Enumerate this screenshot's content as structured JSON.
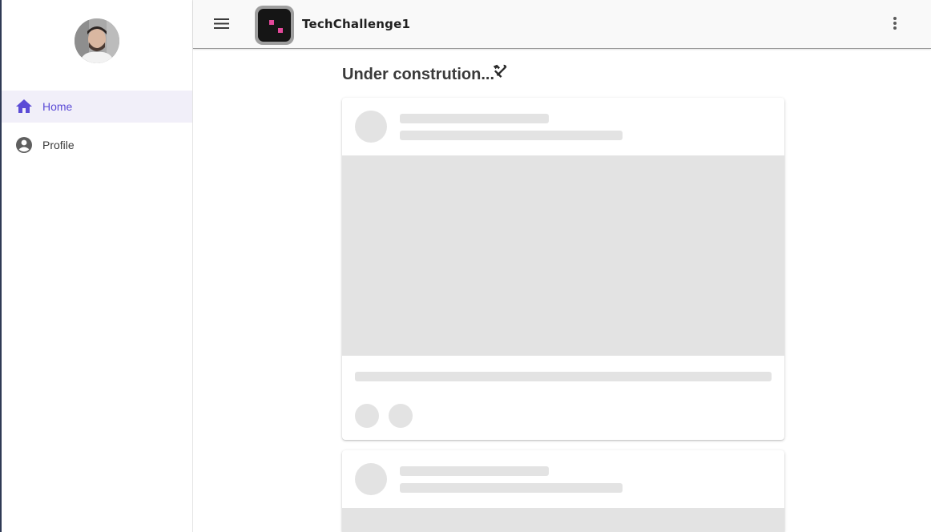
{
  "window": {
    "title": "TechChallenge1"
  },
  "sidebar": {
    "user_avatar_alt": "User avatar",
    "items": [
      {
        "label": "Home",
        "icon": "home-icon",
        "active": true
      },
      {
        "label": "Profile",
        "icon": "account-circle-icon",
        "active": false
      }
    ]
  },
  "header": {
    "app_title": "TechChallenge1",
    "menu_icon": "menu-icon",
    "more_icon": "more-vert-icon"
  },
  "main": {
    "page_title": "Under constrution...",
    "title_icon": "tools-icon"
  },
  "colors": {
    "accent": "#5b4bd6",
    "active_bg": "#f1eff9",
    "skeleton": "#e3e3e3",
    "logo_pink": "#e4499b"
  }
}
